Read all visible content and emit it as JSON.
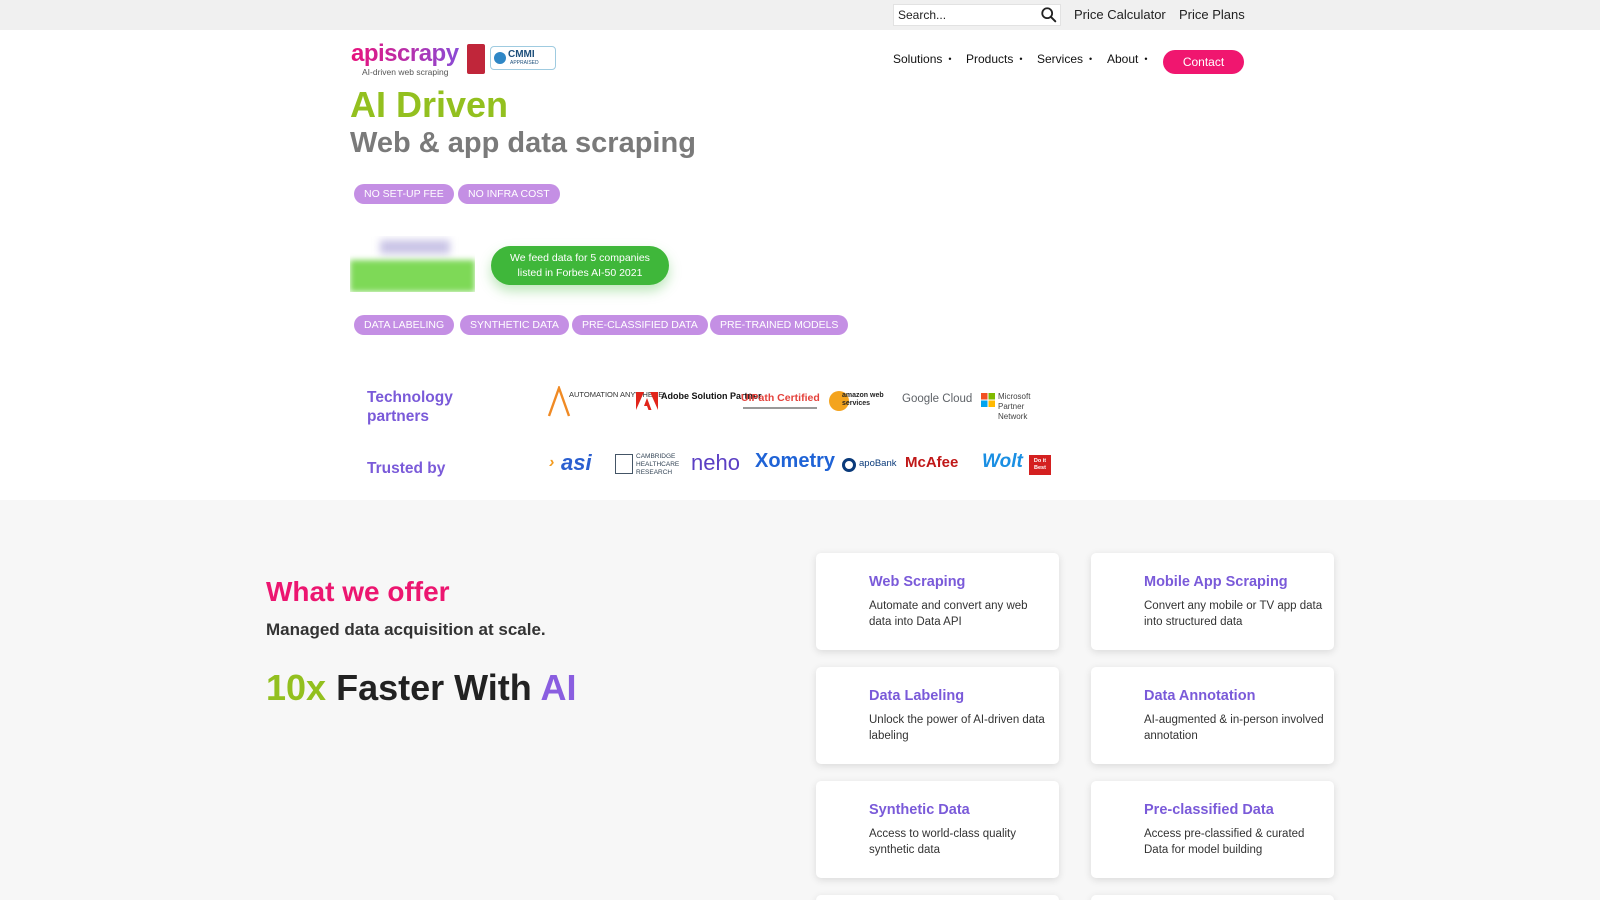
{
  "utility_bar": {
    "search_placeholder": "Search...",
    "links": [
      "Price Calculator",
      "Price Plans"
    ]
  },
  "header": {
    "logo_text": "apiscrapy",
    "logo_tagline": "AI-driven web scraping",
    "cmmi_badge": "CMMI",
    "cmmi_badge_sub": "APPRAISED",
    "nav": [
      "Solutions",
      "Products",
      "Services",
      "About"
    ],
    "contact_label": "Contact"
  },
  "hero": {
    "title": "AI Driven",
    "subtitle": "Web & app data scraping",
    "pills_top": [
      "NO SET-UP FEE",
      "NO INFRA COST"
    ],
    "forbes_line1": "We feed data for 5 companies",
    "forbes_line2": "listed in Forbes AI-50 2021",
    "pills_bottom": [
      "DATA LABELING",
      "SYNTHETIC DATA",
      "PRE-CLASSIFIED DATA",
      "PRE-TRAINED MODELS"
    ]
  },
  "partners": {
    "technology_label_1": "Technology",
    "technology_label_2": "partners",
    "technology_logos": [
      "AUTOMATION ANYWHERE",
      "Adobe Solution Partner",
      "UiPath Certified",
      "amazon web services",
      "Google Cloud",
      "Microsoft Partner Network"
    ],
    "trusted_label": "Trusted by",
    "trusted_logos": [
      "asi",
      "CAMBRIDGE HEALTHCARE RESEARCH",
      "neho",
      "Xometry",
      "apoBank",
      "McAfee",
      "Wolt",
      "Do it Best"
    ]
  },
  "offer": {
    "title": "What we offer",
    "subtitle": "Managed data acquisition at scale.",
    "faster_1": "10x",
    "faster_2": " Faster With ",
    "faster_3": "AI",
    "cards": [
      {
        "title": "Web Scraping",
        "desc": "Automate and convert any web data into Data API"
      },
      {
        "title": "Mobile App Scraping",
        "desc": "Convert any mobile or TV app data into structured data"
      },
      {
        "title": "Data Labeling",
        "desc": "Unlock the power of AI-driven data labeling"
      },
      {
        "title": "Data Annotation",
        "desc": "AI-augmented & in-person involved annotation"
      },
      {
        "title": "Synthetic Data",
        "desc": "Access to world-class quality synthetic data"
      },
      {
        "title": "Pre-classified Data",
        "desc": "Access pre-classified & curated Data for model building"
      }
    ]
  },
  "colors": {
    "brand_pink": "#ec1670",
    "brand_green": "#93c01f",
    "brand_purple": "#7a5ad9",
    "pill_purple": "#c48fe4",
    "forbes_green": "#3fb73a"
  }
}
